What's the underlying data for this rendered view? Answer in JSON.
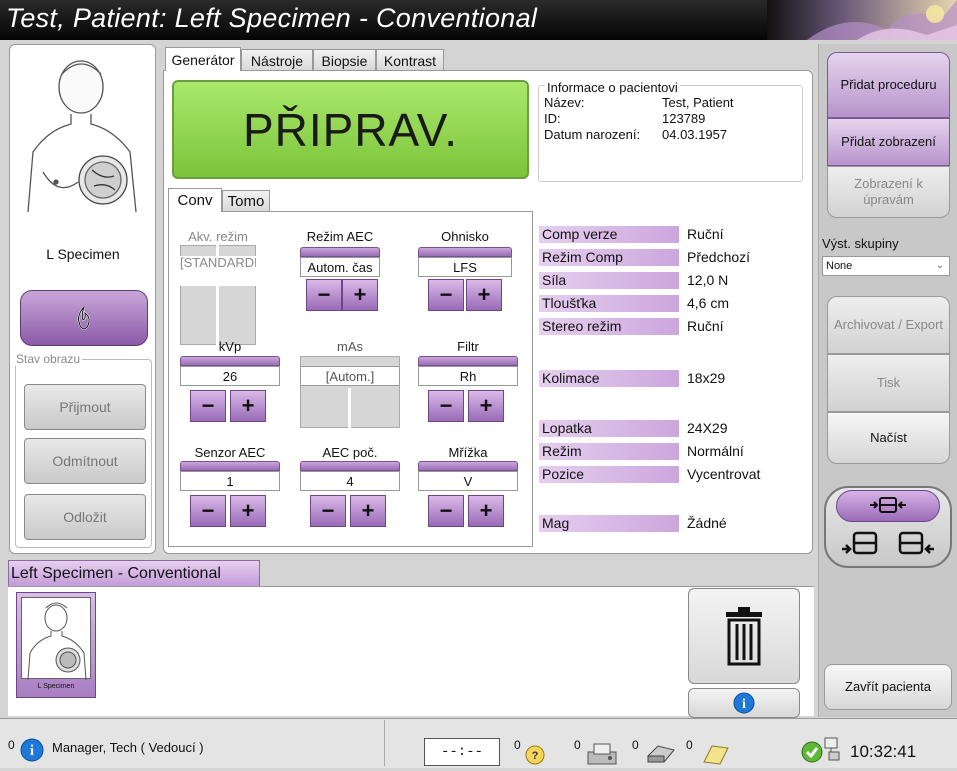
{
  "title": "Test, Patient:  Left Specimen - Conventional",
  "left": {
    "specimen_label": "L Specimen",
    "image_state_legend": "Stav obrazu",
    "accept": "Přijmout",
    "reject": "Odmítnout",
    "pend": "Odložit"
  },
  "tabs": [
    "Generátor",
    "Nástroje",
    "Biopsie",
    "Kontrast"
  ],
  "status_display": "PŘIPRAV.",
  "patient": {
    "legend": "Informace o pacientovi",
    "name_label": "Název:",
    "name": "Test, Patient",
    "id_label": "ID:",
    "id": "123789",
    "dob_label": "Datum narození:",
    "dob": "04.03.1957"
  },
  "subtabs": [
    "Conv",
    "Tomo"
  ],
  "controls": {
    "acq_mode": {
      "label": "Akv. režim",
      "value": "[STANDARDNÍ]"
    },
    "aec_mode": {
      "label": "Režim AEC",
      "value": "Autom. čas"
    },
    "focus": {
      "label": "Ohnisko",
      "value": "LFS"
    },
    "kvp": {
      "label": "kVp",
      "value": "26"
    },
    "mas": {
      "label": "mAs",
      "value": "[Autom.]"
    },
    "filter": {
      "label": "Filtr",
      "value": "Rh"
    },
    "aec_sensor": {
      "label": "Senzor AEC",
      "value": "1"
    },
    "aec_count": {
      "label": "AEC poč.",
      "value": "4"
    },
    "grid": {
      "label": "Mřížka",
      "value": "V"
    },
    "minus": "−",
    "plus": "+"
  },
  "info": [
    {
      "k": "Comp verze",
      "v": "Ruční"
    },
    {
      "k": "Režim Comp",
      "v": "Předchozí"
    },
    {
      "k": "Síla",
      "v": "12,0 N"
    },
    {
      "k": "Tloušťka",
      "v": "4,6 cm"
    },
    {
      "k": "Stereo režim",
      "v": "Ruční"
    },
    {
      "k": "Kolimace",
      "v": "18x29"
    },
    {
      "k": "Lopatka",
      "v": "24X29"
    },
    {
      "k": "Režim",
      "v": "Normální"
    },
    {
      "k": "Pozice",
      "v": "Vycentrovat"
    },
    {
      "k": "Mag",
      "v": "Žádné"
    }
  ],
  "right": {
    "add_procedure": "Přidat proceduru",
    "add_view": "Přidat zobrazení",
    "edit_view": "Zobrazení k úpravám",
    "output_groups_label": "Výst. skupiny",
    "output_groups_value": "None",
    "archive": "Archivovat / Export",
    "print": "Tisk",
    "retrieve": "Načíst",
    "close_patient": "Zavřít pacienta"
  },
  "procedure_label": "Left Specimen - Conventional",
  "thumb_label": "L Specimen",
  "status_bar": {
    "count0": "0",
    "user": "Manager, Tech ( Vedoucí )",
    "timer": "--:--",
    "count1": "0",
    "count2": "0",
    "count3": "0",
    "count4": "0",
    "clock": "10:32:41"
  },
  "colors": {
    "accent": "#9b6bb8",
    "ready": "#8fd44a",
    "titlebar": "#111111"
  }
}
